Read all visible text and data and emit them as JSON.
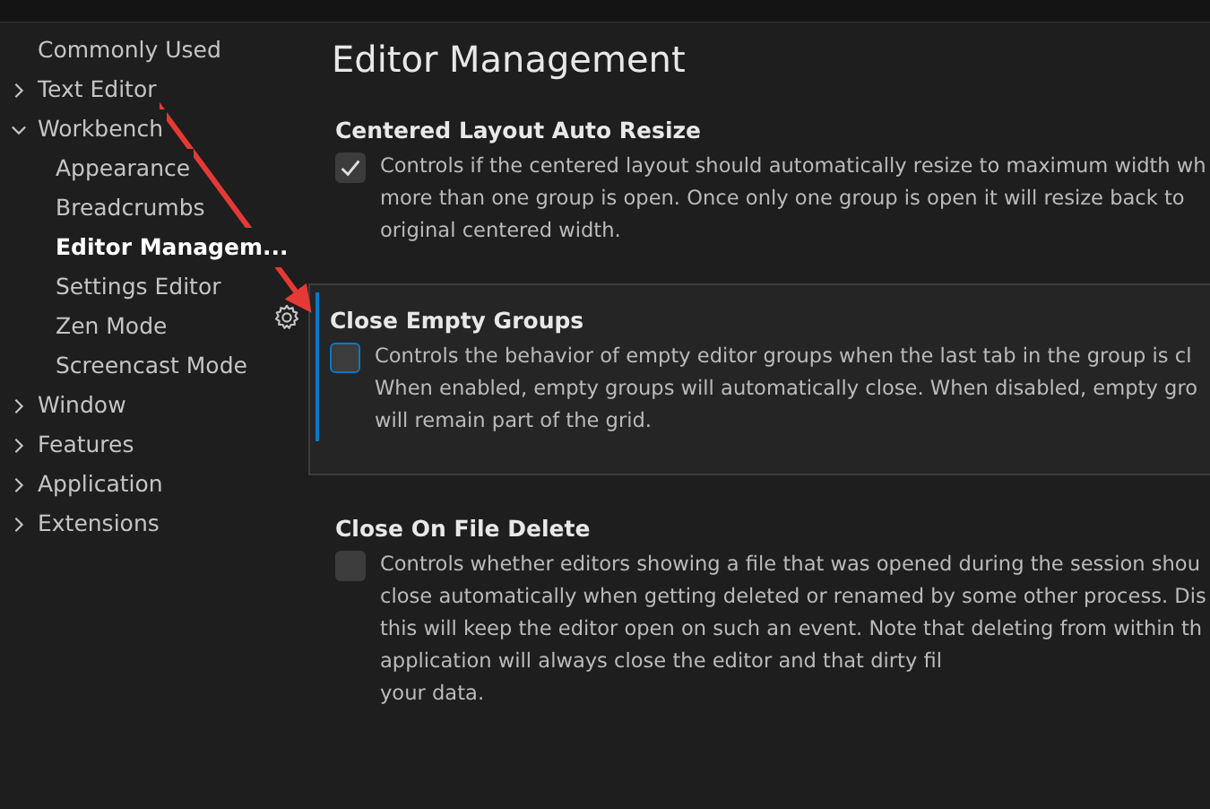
{
  "sidebar": {
    "items": [
      {
        "label": "Commonly Used",
        "selected": false
      },
      {
        "label": "Text Editor",
        "selected": false,
        "expanded": false
      },
      {
        "label": "Workbench",
        "selected": false,
        "expanded": true,
        "children": [
          {
            "label": "Appearance",
            "selected": false
          },
          {
            "label": "Breadcrumbs",
            "selected": false
          },
          {
            "label": "Editor Managem...",
            "selected": true
          },
          {
            "label": "Settings Editor",
            "selected": false
          },
          {
            "label": "Zen Mode",
            "selected": false
          },
          {
            "label": "Screencast Mode",
            "selected": false
          }
        ]
      },
      {
        "label": "Window",
        "selected": false,
        "expanded": false
      },
      {
        "label": "Features",
        "selected": false,
        "expanded": false
      },
      {
        "label": "Application",
        "selected": false,
        "expanded": false
      },
      {
        "label": "Extensions",
        "selected": false,
        "expanded": false
      }
    ]
  },
  "page_title": "Editor Management",
  "settings": [
    {
      "title": "Centered Layout Auto Resize",
      "checked": true,
      "focused": false,
      "description": [
        "Controls if the centered layout should automatically resize to maximum width wh",
        "more than one group is open. Once only one group is open it will resize back to",
        "original centered width."
      ]
    },
    {
      "title": "Close Empty Groups",
      "checked": false,
      "focused": true,
      "description": [
        "Controls the behavior of empty editor groups when the last tab in the group is cl",
        "When enabled, empty groups will automatically close. When disabled, empty gro",
        "will remain part of the grid."
      ]
    },
    {
      "title": "Close On File Delete",
      "checked": false,
      "focused": false,
      "description": [
        "Controls whether editors showing a file that was opened during the session shou",
        "close automatically when getting deleted or renamed by some other process. Dis",
        "this will keep the editor open on such an event. Note that deleting from within th",
        "application will always close the editor and that dirty fil",
        "your data."
      ]
    }
  ]
}
